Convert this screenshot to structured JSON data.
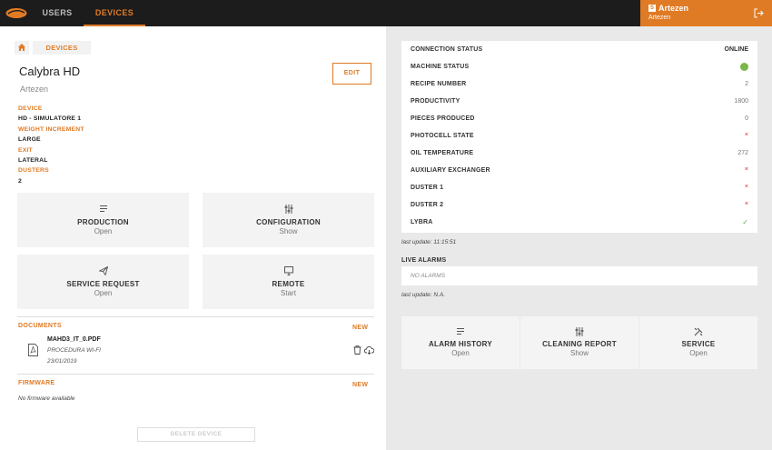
{
  "header": {
    "nav": [
      {
        "label": "USERS"
      },
      {
        "label": "DEVICES"
      }
    ],
    "user": {
      "badge": "S",
      "name": "Artezen",
      "company": "Artezen"
    }
  },
  "breadcrumb": {
    "current": "DEVICES"
  },
  "device": {
    "title": "Calybra HD",
    "owner": "Artezen",
    "edit_label": "EDIT",
    "specs": [
      {
        "key": "DEVICE",
        "value": "HD - SIMULATORE 1"
      },
      {
        "key": "WEIGHT INCREMENT",
        "value": "LARGE"
      },
      {
        "key": "EXIT",
        "value": "LATERAL"
      },
      {
        "key": "DUSTERS",
        "value": "2"
      }
    ]
  },
  "actions": [
    {
      "title": "PRODUCTION",
      "sub": "Open",
      "icon": "list-icon"
    },
    {
      "title": "CONFIGURATION",
      "sub": "Show",
      "icon": "sliders-icon"
    },
    {
      "title": "SERVICE REQUEST",
      "sub": "Open",
      "icon": "send-icon"
    },
    {
      "title": "REMOTE",
      "sub": "Start",
      "icon": "monitor-icon"
    }
  ],
  "documents": {
    "title": "DOCUMENTS",
    "new_label": "NEW",
    "items": [
      {
        "name": "MAHD3_IT_0.PDF",
        "desc": "PROCEDURA WI-FI",
        "date": "23/01/2019"
      }
    ]
  },
  "firmware": {
    "title": "FIRMWARE",
    "new_label": "NEW",
    "empty": "No firmware available"
  },
  "delete_label": "DELETE DEVICE",
  "status": {
    "rows": [
      {
        "label": "CONNECTION STATUS",
        "value": "ONLINE",
        "kind": "bold"
      },
      {
        "label": "MACHINE STATUS",
        "value": "",
        "kind": "dot"
      },
      {
        "label": "RECIPE NUMBER",
        "value": "2",
        "kind": "text"
      },
      {
        "label": "PRODUCTIVITY",
        "value": "1800",
        "kind": "text"
      },
      {
        "label": "PIECES PRODUCED",
        "value": "0",
        "kind": "text"
      },
      {
        "label": "PHOTOCELL STATE",
        "value": "×",
        "kind": "x"
      },
      {
        "label": "OIL TEMPERATURE",
        "value": "272",
        "kind": "text"
      },
      {
        "label": "AUXILIARY EXCHANGER",
        "value": "×",
        "kind": "x"
      },
      {
        "label": "DUSTER 1",
        "value": "×",
        "kind": "x"
      },
      {
        "label": "DUSTER 2",
        "value": "×",
        "kind": "x"
      },
      {
        "label": "LYBRA",
        "value": "✓",
        "kind": "ok"
      }
    ],
    "last_update": "last update: 11:15:51",
    "status_dot_color": "#7ab648"
  },
  "alarms": {
    "title": "LIVE ALARMS",
    "empty": "NO ALARMS",
    "last_update": "last update: N.A."
  },
  "reports": [
    {
      "title": "ALARM HISTORY",
      "sub": "Open",
      "icon": "list-icon"
    },
    {
      "title": "CLEANING REPORT",
      "sub": "Show",
      "icon": "sliders-icon"
    },
    {
      "title": "SERVICE",
      "sub": "Open",
      "icon": "tools-icon"
    }
  ],
  "colors": {
    "accent": "#e07b25",
    "topbar": "#1c1c1c",
    "right_bg": "#e9e9e9"
  }
}
